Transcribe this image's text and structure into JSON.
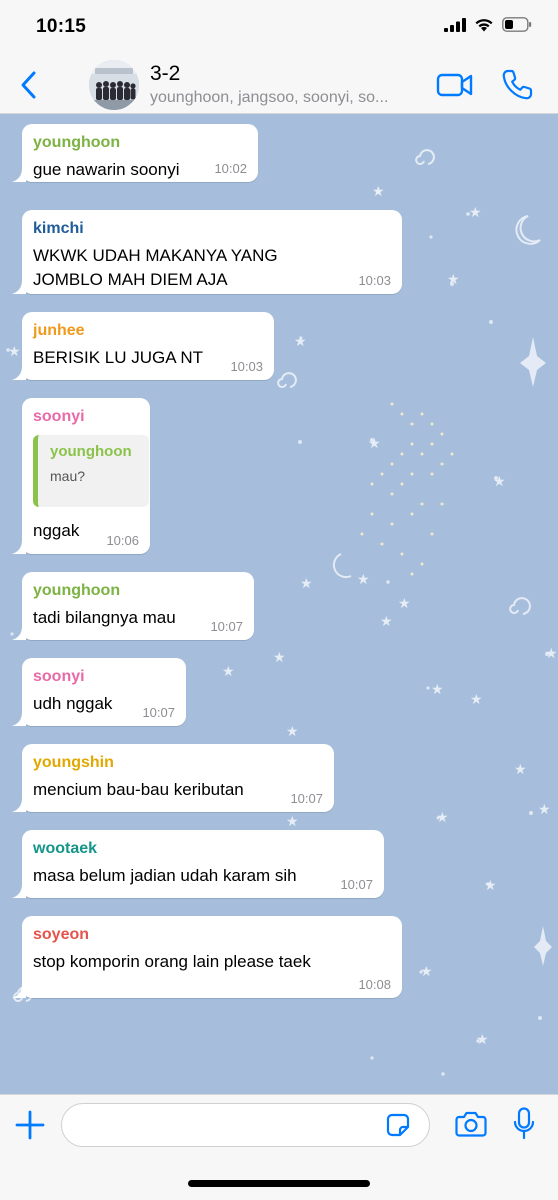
{
  "status_bar": {
    "time": "10:15"
  },
  "header": {
    "title": "3-2",
    "members": "younghoon, jangsoo, soonyi, so..."
  },
  "messages": [
    {
      "sender": "younghoon",
      "sender_color": "#7cb342",
      "text": "gue nawarin soonyi",
      "time": "10:02"
    },
    {
      "sender": "kimchi",
      "sender_color": "#1f5c99",
      "text": "WKWK UDAH MAKANYA YANG JOMBLO MAH DIEM AJA",
      "time": "10:03"
    },
    {
      "sender": "junhee",
      "sender_color": "#ef9a1a",
      "text": "BERISIK LU JUGA NT",
      "time": "10:03"
    },
    {
      "sender": "soonyi",
      "sender_color": "#e86aa8",
      "text": "nggak",
      "time": "10:06",
      "reply": {
        "sender": "younghoon",
        "text": "mau?"
      }
    },
    {
      "sender": "younghoon",
      "sender_color": "#7cb342",
      "text": "tadi bilangnya mau",
      "time": "10:07"
    },
    {
      "sender": "soonyi",
      "sender_color": "#e86aa8",
      "text": "udh nggak",
      "time": "10:07"
    },
    {
      "sender": "youngshin",
      "sender_color": "#e0a800",
      "text": "mencium bau-bau keributan",
      "time": "10:07"
    },
    {
      "sender": "wootaek",
      "sender_color": "#15958a",
      "text": "masa belum jadian udah karam sih",
      "time": "10:07"
    },
    {
      "sender": "soyeon",
      "sender_color": "#e5534b",
      "text": "stop komporin orang lain please taek",
      "time": "10:08"
    }
  ],
  "composer": {
    "input_value": "",
    "input_placeholder": ""
  },
  "icons": {
    "back": "chevron-left-icon",
    "video": "video-camera-icon",
    "call": "phone-icon",
    "plus": "plus-icon",
    "sticker": "sticker-icon",
    "camera": "camera-icon",
    "mic": "microphone-icon"
  },
  "colors": {
    "accent": "#007aff",
    "chat_background": "#a6bedb",
    "bubble": "#ffffff"
  }
}
